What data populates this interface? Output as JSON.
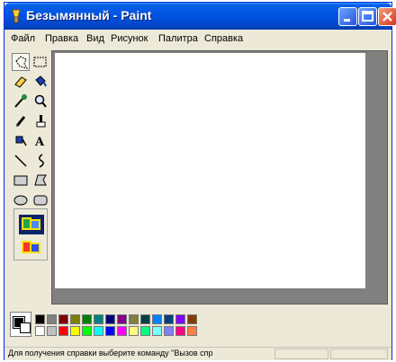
{
  "window": {
    "title": "Безымянный - Paint",
    "controls": [
      "minimize-icon",
      "maximize-icon",
      "close-icon"
    ]
  },
  "menu": [
    "Файл",
    "Правка",
    "Вид",
    "Рисунок",
    "Палитра",
    "Справка"
  ],
  "tools": [
    "free-form-select-icon",
    "rect-select-icon",
    "eraser-icon",
    "fill-icon",
    "color-picker-icon",
    "magnifier-icon",
    "pencil-icon",
    "brush-icon",
    "airbrush-icon",
    "text-icon",
    "line-icon",
    "curve-icon",
    "rectangle-icon",
    "polygon-icon",
    "ellipse-icon",
    "rounded-rect-icon"
  ],
  "active_tool": "free-form-select-icon",
  "tool_options": [
    "opaque-background-icon",
    "transparent-background-icon"
  ],
  "colors": {
    "foreground": "#000000",
    "background": "#ffffff",
    "palette_top": [
      "#000000",
      "#808080",
      "#800000",
      "#808000",
      "#008000",
      "#008080",
      "#000080",
      "#800080",
      "#808040",
      "#004040",
      "#0080ff",
      "#004080",
      "#8000ff",
      "#804000"
    ],
    "palette_bottom": [
      "#ffffff",
      "#c0c0c0",
      "#ff0000",
      "#ffff00",
      "#00ff00",
      "#00ffff",
      "#0000ff",
      "#ff00ff",
      "#ffff80",
      "#00ff80",
      "#80ffff",
      "#8080ff",
      "#ff0080",
      "#ff8040"
    ]
  },
  "status": {
    "text": "Для получения справки выберите команду \"Вызов спр"
  }
}
